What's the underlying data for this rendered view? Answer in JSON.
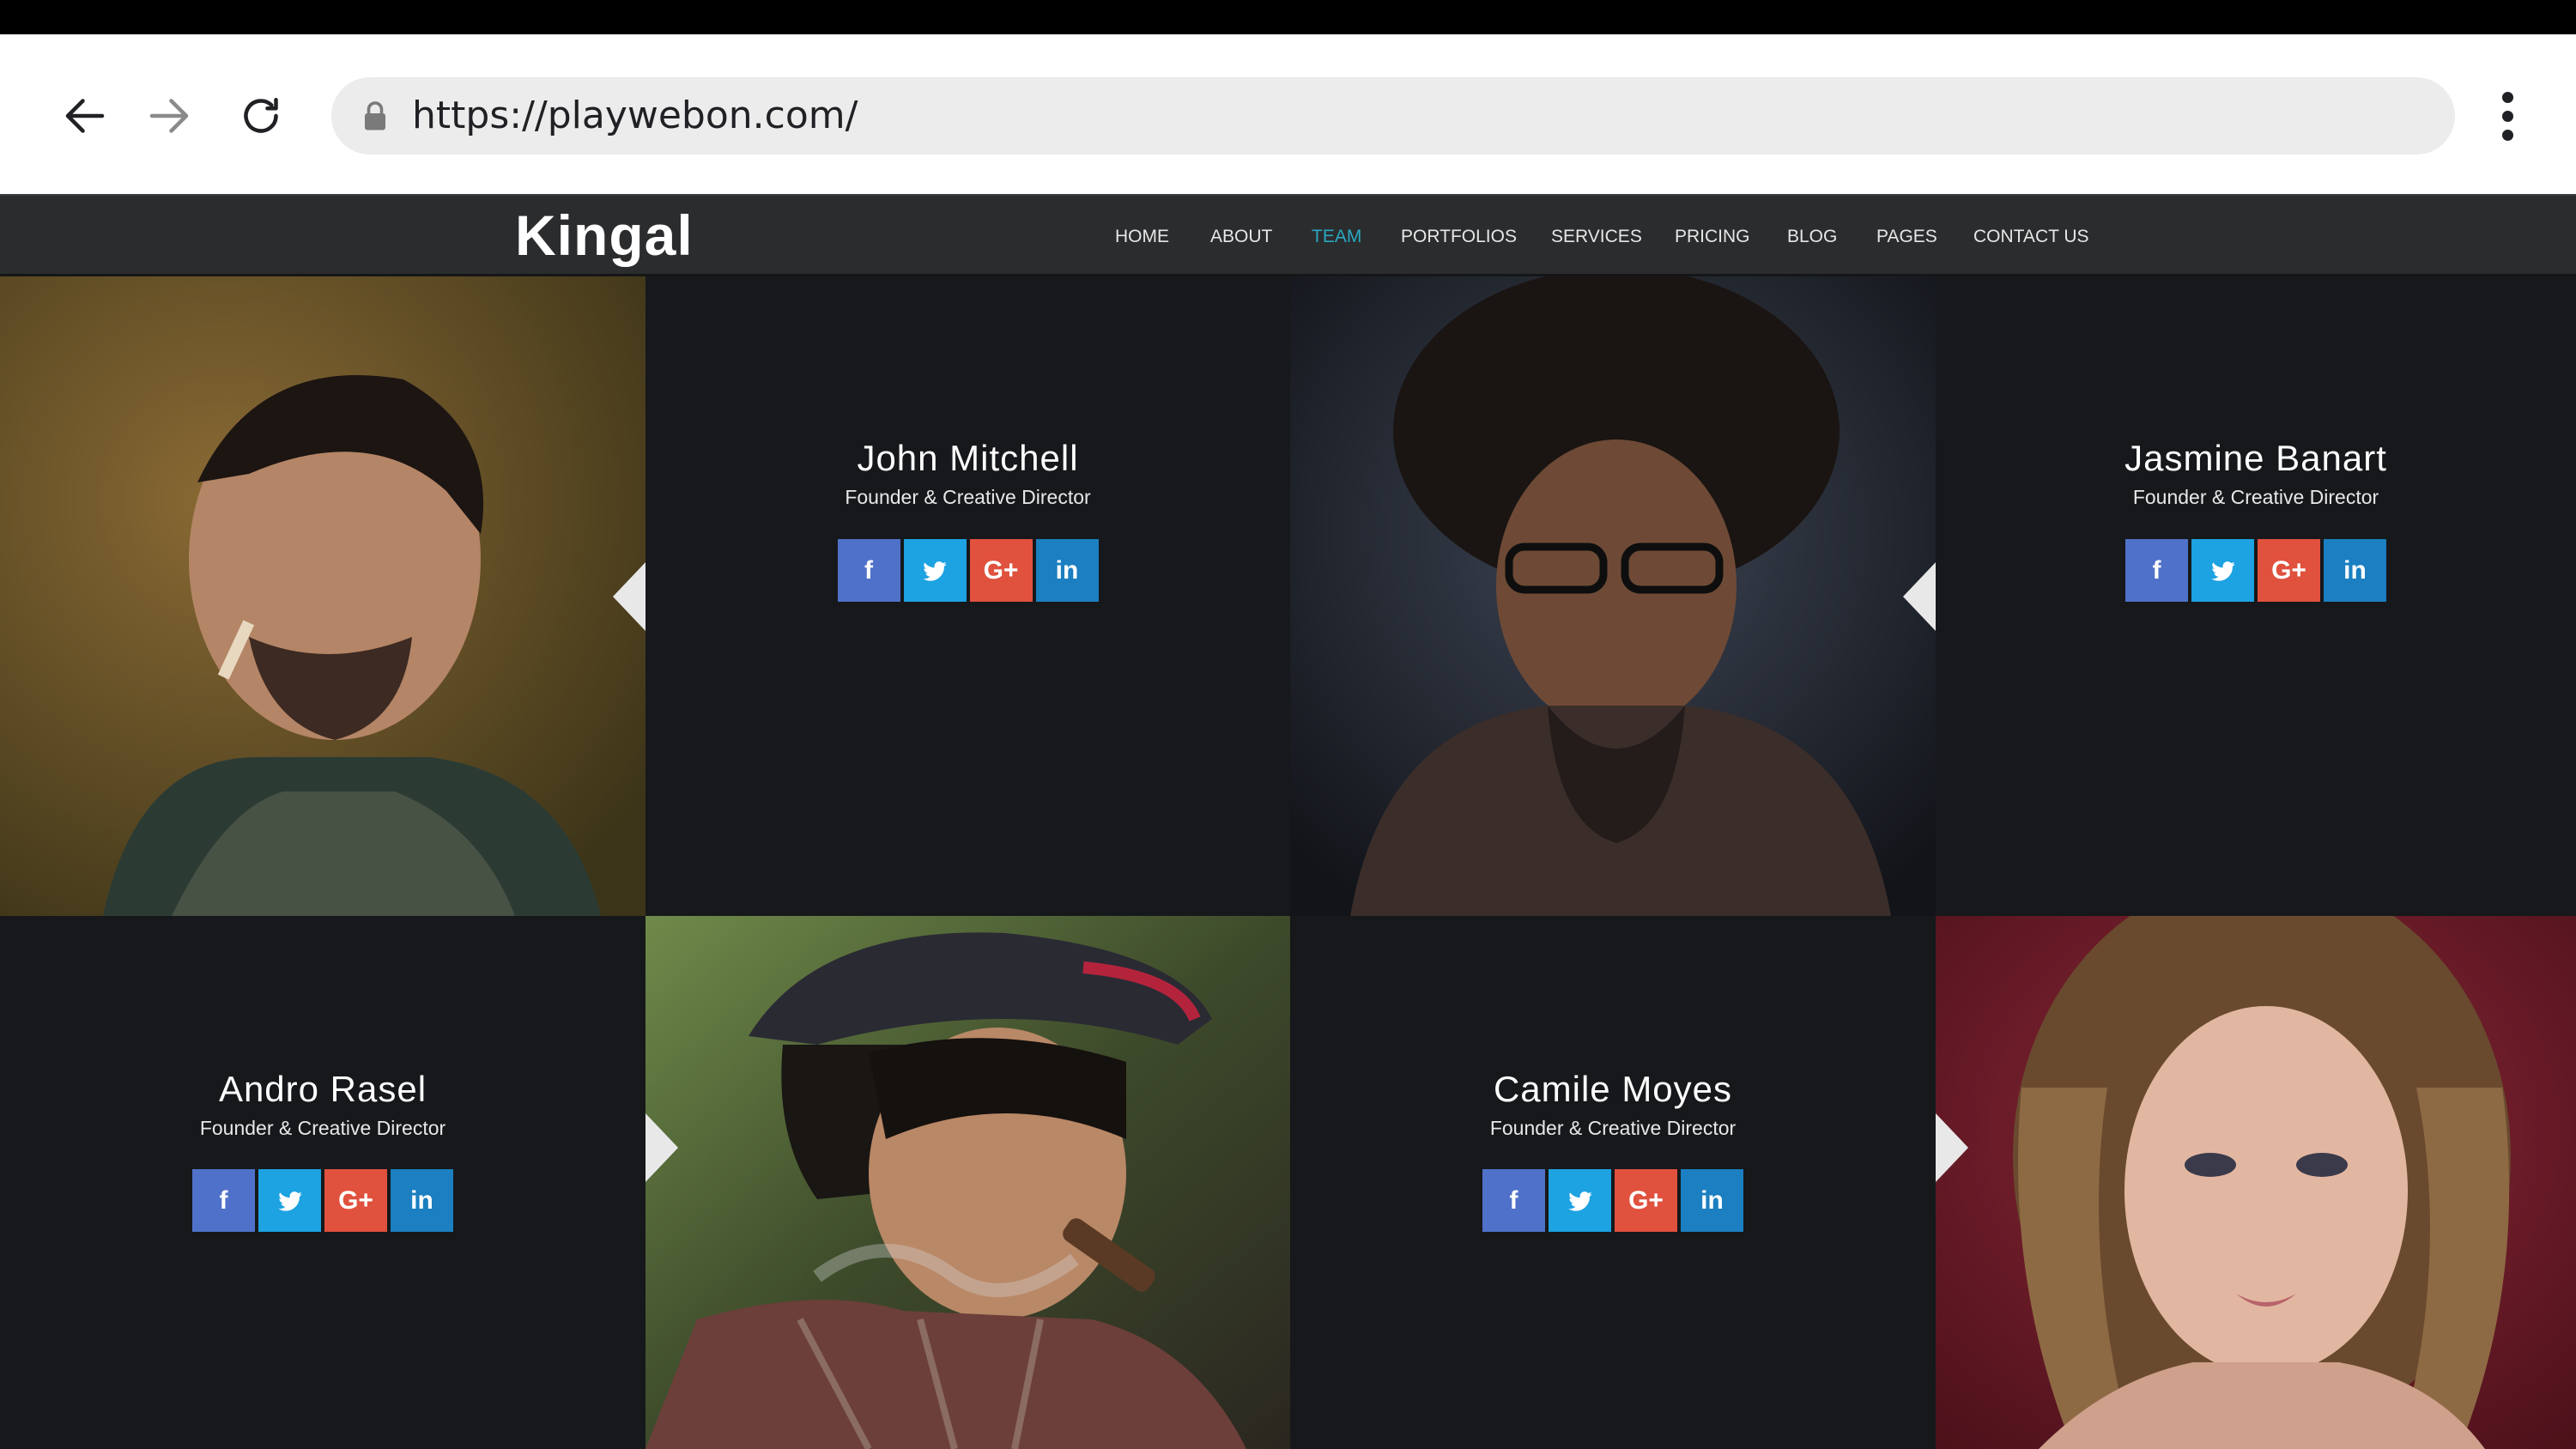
{
  "browser": {
    "url": "https://playwebon.com/",
    "icons": [
      "back-arrow-icon",
      "forward-arrow-icon",
      "reload-icon",
      "lock-icon",
      "more-vert-icon"
    ]
  },
  "site": {
    "logo": "Kingal",
    "nav": [
      {
        "label": "HOME",
        "active": false
      },
      {
        "label": "ABOUT",
        "active": false
      },
      {
        "label": "TEAM",
        "active": true
      },
      {
        "label": "PORTFOLIOS",
        "active": false
      },
      {
        "label": "SERVICES",
        "active": false
      },
      {
        "label": "PRICING",
        "active": false
      },
      {
        "label": "BLOG",
        "active": false
      },
      {
        "label": "PAGES",
        "active": false
      },
      {
        "label": "CONTACT US",
        "active": false
      }
    ],
    "accent_color": "#2aa8c0"
  },
  "team": {
    "members": [
      {
        "name": "John Mitchell",
        "role": "Founder & Creative Director"
      },
      {
        "name": "Jasmine Banart",
        "role": "Founder & Creative Director"
      },
      {
        "name": "Andro Rasel",
        "role": "Founder & Creative Director"
      },
      {
        "name": "Camile Moyes",
        "role": "Founder & Creative Director"
      }
    ],
    "social": {
      "facebook": "f",
      "google_plus": "G+",
      "linkedin": "in"
    },
    "social_colors": {
      "facebook": "#4f71c9",
      "twitter": "#1da2e2",
      "google_plus": "#e0513e",
      "linkedin": "#1b7fc1"
    }
  }
}
